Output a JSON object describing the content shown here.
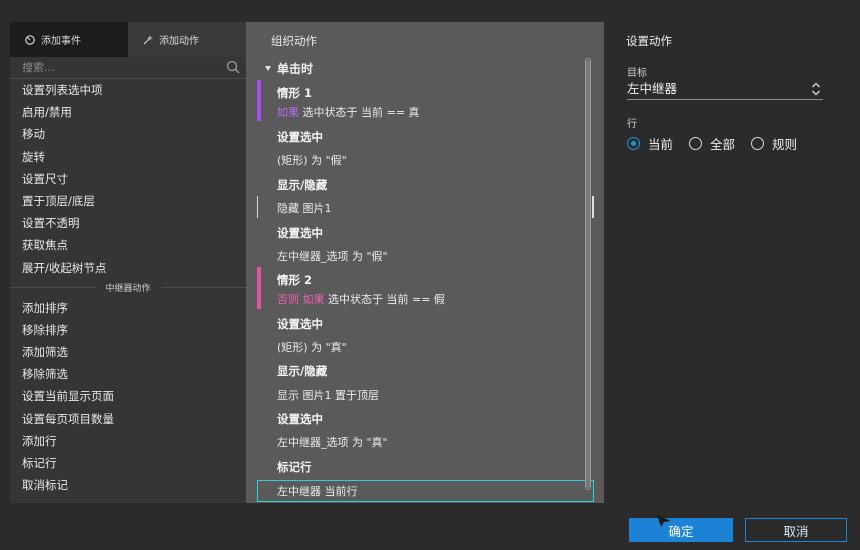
{
  "left": {
    "tabs": [
      {
        "label": "添加事件",
        "icon": "event-icon",
        "active": false
      },
      {
        "label": "添加动作",
        "icon": "action-sparkle-icon",
        "active": true
      }
    ],
    "search_placeholder": "搜索...",
    "actions": [
      "设置列表选中项",
      "启用/禁用",
      "移动",
      "旋转",
      "设置尺寸",
      "置于顶层/底层",
      "设置不透明",
      "获取焦点",
      "展开/收起树节点"
    ],
    "repeater_group_label": "中继器动作",
    "repeater_actions": [
      "添加排序",
      "移除排序",
      "添加筛选",
      "移除筛选",
      "设置当前显示页面",
      "设置每页项目数量",
      "添加行",
      "标记行",
      "取消标记"
    ]
  },
  "middle": {
    "title": "组织动作",
    "event": "单击时",
    "case1": {
      "name": "情形 1",
      "keyword": "如果",
      "condition": "选中状态于 当前 == 真",
      "color": "#a54ff0"
    },
    "a1": {
      "title": "设置选中",
      "detail": "(矩形) 为 \"假\""
    },
    "a2": {
      "title": "显示/隐藏",
      "detail": "隐藏 图片1"
    },
    "a3": {
      "title": "设置选中",
      "detail": "左中继器_选项 为 \"假\""
    },
    "case2": {
      "name": "情形 2",
      "keyword_else": "否则",
      "keyword_if": "如果",
      "condition": "选中状态于 当前 == 假",
      "color": "#e0559f"
    },
    "b1": {
      "title": "设置选中",
      "detail": "(矩形) 为 \"真\""
    },
    "b2": {
      "title": "显示/隐藏",
      "detail": "显示 图片1  置于顶层"
    },
    "b3": {
      "title": "设置选中",
      "detail": "左中继器_选项 为 \"真\""
    },
    "b4": {
      "title": "标记行",
      "detail": "左中继器 当前行"
    }
  },
  "right": {
    "title": "设置动作",
    "target_label": "目标",
    "target_value": "左中继器",
    "row_label": "行",
    "options": [
      {
        "label": "当前",
        "selected": true
      },
      {
        "label": "全部",
        "selected": false
      },
      {
        "label": "规则",
        "selected": false
      }
    ]
  },
  "footer": {
    "ok": "确定",
    "cancel": "取消"
  },
  "colors": {
    "accent": "#1b82d6",
    "selection": "#2fd0da"
  }
}
